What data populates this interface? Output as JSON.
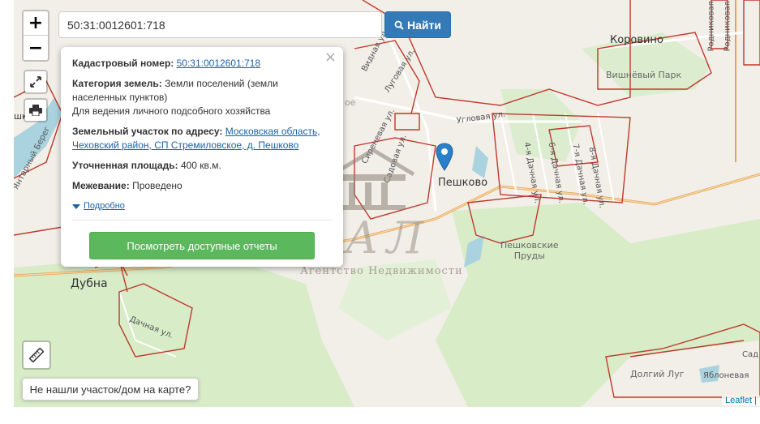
{
  "search": {
    "value": "50:31:0012601:718",
    "button_label": "Найти"
  },
  "zoom": {
    "in_label": "+",
    "out_label": "−"
  },
  "popup": {
    "cadastral_label": "Кадастровый номер:",
    "cadastral_value": "50:31:0012601:718",
    "category_label": "Категория земель:",
    "category_value": "Земли поселений (земли населенных пунктов)",
    "category_use": "Для ведения личного подсобного хозяйства",
    "address_label": "Земельный участок по адресу:",
    "address_value": "Московская область, Чеховский район, СП Стремиловское, д. Пешково",
    "area_label": "Уточненная площадь:",
    "area_value": "400 кв.м.",
    "survey_label": "Межевание:",
    "survey_value": "Проведено",
    "more_label": "Подробно",
    "reports_button": "Посмотреть доступные отчеты",
    "close_label": "×"
  },
  "not_found_label": "Не нашли участок/дом на карте?",
  "attribution": {
    "leaflet": "Leaflet",
    "sep": " |"
  },
  "map_labels": {
    "koroвino": "Коровино",
    "peshkovo": "Пешково",
    "dubna": "Дубна",
    "vishnevy": "Вишнёвый Парк",
    "prudy": "Пешковские\nПруды",
    "dolgiy_lug": "Долгий Луг",
    "yablonevaya": "Яблоневая",
    "sad": "Сад",
    "shk": "шк",
    "oe": "ое",
    "rodnikovaya1": "Родниковая",
    "rodnikovaya2": "Родниковая"
  },
  "streets": {
    "vidnaya": "Видная ул.",
    "lugovaya": "Луговая ул.",
    "uglovaya": "Угловая ул.",
    "sirenevaya": "Сиреневая ул.",
    "sadovaya": "Садовая ул.",
    "dachnaya4": "4-я Дачная ул.",
    "dachnaya6": "6-я Дачная ул.",
    "dachnaya7": "7-я Дачная ул.",
    "dachnaya8": "8-я Дачная ул.",
    "dachnaya": "Дачная ул.",
    "yantarny": "Янтарный Берег"
  },
  "watermark": {
    "brand": "РЕАЛ",
    "subtitle": "Агентство Недвижимости"
  },
  "icons": [
    "fullscreen-icon",
    "print-icon",
    "ruler-icon",
    "search-icon",
    "map-marker-icon"
  ],
  "colors": {
    "primary": "#337ab7",
    "success": "#5cb85c",
    "parcel_border": "#c0392b",
    "road": "#e8a255",
    "forest": "#d7ecc9",
    "water": "#aad3df"
  }
}
